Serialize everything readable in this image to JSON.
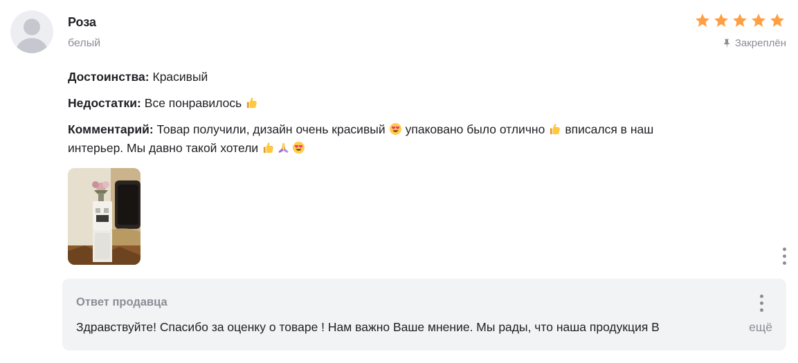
{
  "review": {
    "author": "Роза",
    "variant": "белый",
    "rating": 5,
    "rating_max": 5,
    "star_color": "#ff9f43",
    "pinned_label": "Закреплён",
    "pros_label": "Достоинства:",
    "pros_text": "Красивый",
    "cons_label": "Недостатки:",
    "cons_text": "Все понравилось",
    "comment_label": "Комментарий:",
    "comment_part1": "Товар получили, дизайн очень красивый",
    "comment_part2": "упаковано было отлично",
    "comment_part3": "вписался в наш",
    "comment_part4": "интерьер. Мы давно такой хотели",
    "emojis": [
      "thumbs-up",
      "heart-eyes",
      "folded-hands"
    ]
  },
  "seller_reply": {
    "title": "Ответ продавца",
    "text": "Здравствуйте! Спасибо за оценку о товаре ! Нам важно Ваше мнение. Мы рады, что наша продукция В",
    "more_label": "ещё"
  },
  "icons": {
    "avatar": "user-avatar-placeholder",
    "star": "star-icon",
    "pin": "pin-icon",
    "menu": "kebab-menu-icon"
  }
}
